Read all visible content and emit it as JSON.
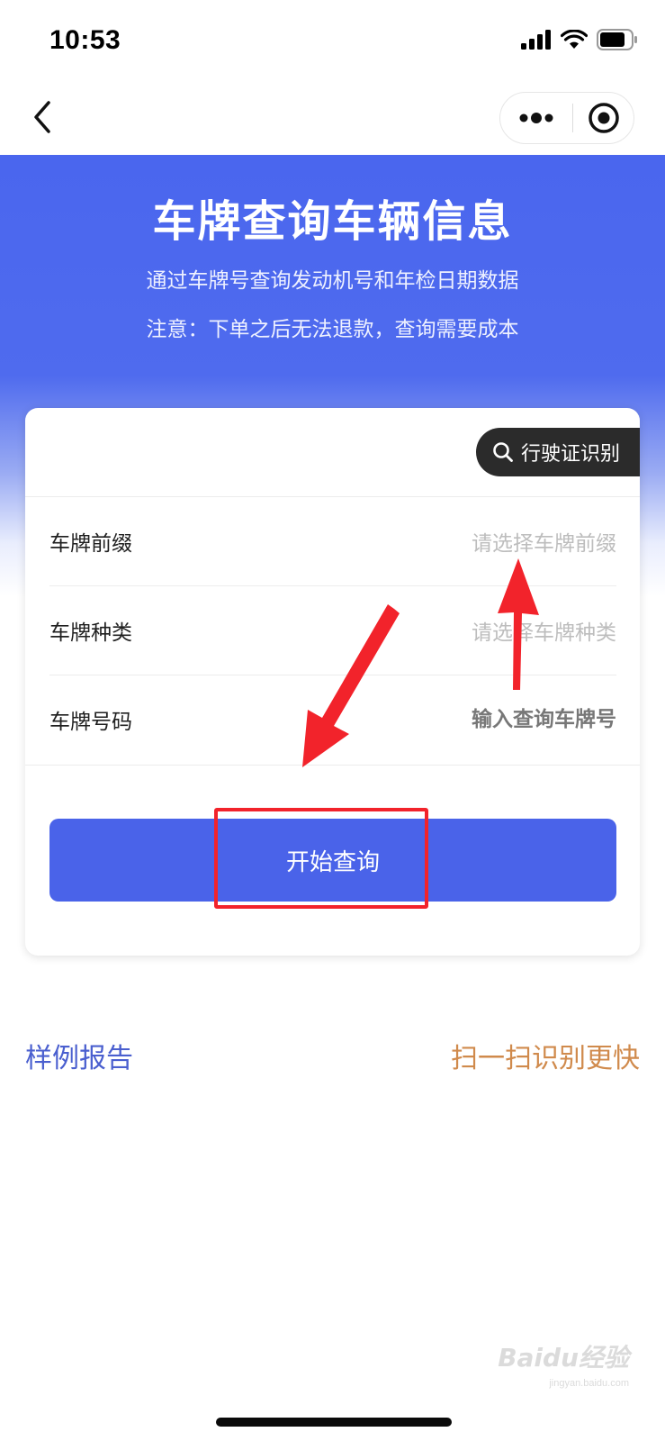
{
  "status_bar": {
    "time": "10:53"
  },
  "nav": {
    "back_icon": "chevron-left-icon",
    "more_icon": "more-dots-icon",
    "close_icon": "target-circle-icon"
  },
  "hero": {
    "title": "车牌查询车辆信息",
    "subtitle1": "通过车牌号查询发动机号和年检日期数据",
    "subtitle2": "注意：下单之后无法退款，查询需要成本"
  },
  "card": {
    "ocr_button_label": "行驶证识别",
    "rows": [
      {
        "label": "车牌前缀",
        "placeholder": "请选择车牌前缀"
      },
      {
        "label": "车牌种类",
        "placeholder": "请选择车牌种类"
      },
      {
        "label": "车牌号码",
        "placeholder": "输入查询车牌号"
      }
    ],
    "submit_label": "开始查询"
  },
  "links": {
    "sample_report": "样例报告",
    "scan_faster": "扫一扫识别更快"
  },
  "watermark": {
    "brand": "Baidu经验",
    "url": "jingyan.baidu.com"
  },
  "colors": {
    "primary": "#4a63e9",
    "annotation": "#f2232b",
    "link_blue": "#4a5fcf",
    "link_orange": "#d08a4c"
  }
}
